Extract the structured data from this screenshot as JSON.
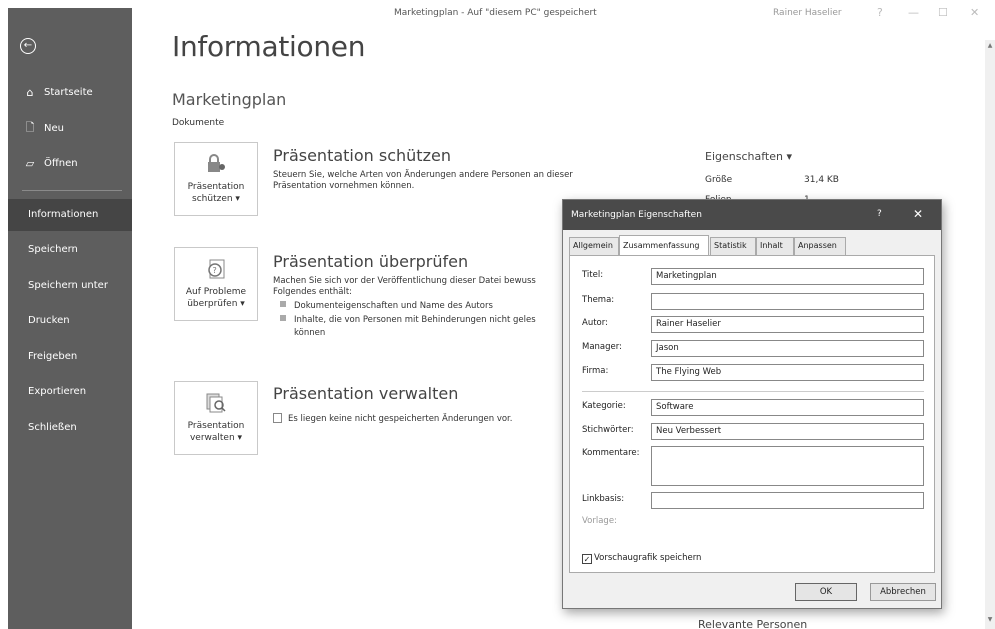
{
  "titlebar": {
    "document_title": "Marketingplan - Auf \"diesem PC\" gespeichert",
    "user": "Rainer Haselier",
    "help": "?",
    "minimize": "—",
    "maximize": "☐",
    "close": "✕"
  },
  "sidebar": {
    "back_glyph": "←",
    "top_items": [
      {
        "label": "Startseite",
        "icon": "home-icon"
      },
      {
        "label": "Neu",
        "icon": "new-document-icon"
      },
      {
        "label": "Öffnen",
        "icon": "folder-open-icon"
      }
    ],
    "items": [
      {
        "label": "Informationen",
        "active": true
      },
      {
        "label": "Speichern"
      },
      {
        "label": "Speichern unter"
      },
      {
        "label": "Drucken"
      },
      {
        "label": "Freigeben"
      },
      {
        "label": "Exportieren"
      },
      {
        "label": "Schließen"
      }
    ]
  },
  "main": {
    "title": "Informationen",
    "doc_name": "Marketingplan",
    "doc_location": "Dokumente",
    "sections": [
      {
        "tile_label_1": "Präsentation",
        "tile_label_2": "schützen ▾",
        "icon": "lock-key-icon",
        "heading": "Präsentation schützen",
        "desc_1": "Steuern Sie, welche Arten von Änderungen andere Personen an dieser",
        "desc_2": "Präsentation vornehmen können."
      },
      {
        "tile_label_1": "Auf Probleme",
        "tile_label_2": "überprüfen ▾",
        "icon": "inspect-document-icon",
        "heading": "Präsentation überprüfen",
        "desc_1": "Machen Sie sich vor der Veröffentlichung dieser Datei bewuss",
        "desc_2": "Folgendes enthält:",
        "bullets": [
          "Dokumenteigenschaften und Name des Autors",
          "Inhalte, die von Personen mit Behinderungen nicht geles",
          "können"
        ]
      },
      {
        "tile_label_1": "Präsentation",
        "tile_label_2": "verwalten ▾",
        "icon": "manage-presentation-icon",
        "heading": "Präsentation verwalten",
        "desc_1": "Es liegen keine nicht gespeicherten Änderungen vor."
      }
    ],
    "properties": {
      "heading": "Eigenschaften ▾",
      "rows": [
        {
          "label": "Größe",
          "value": "31,4 KB"
        },
        {
          "label": "Folien",
          "value": "1"
        }
      ]
    },
    "related_heading": "Relevante Personen"
  },
  "dialog": {
    "title": "Marketingplan Eigenschaften",
    "help": "?",
    "close": "✕",
    "tabs": [
      "Allgemein",
      "Zusammenfassung",
      "Statistik",
      "Inhalt",
      "Anpassen"
    ],
    "active_tab": "Zusammenfassung",
    "fields": [
      {
        "label": "Titel:",
        "value": "Marketingplan"
      },
      {
        "label": "Thema:",
        "value": ""
      },
      {
        "label": "Autor:",
        "value": "Rainer Haselier"
      },
      {
        "label": "Manager:",
        "value": "Jason"
      },
      {
        "label": "Firma:",
        "value": "The Flying Web"
      },
      {
        "label": "Kategorie:",
        "value": "Software"
      },
      {
        "label": "Stichwörter:",
        "value": "Neu Verbessert"
      },
      {
        "label": "Kommentare:",
        "value": ""
      },
      {
        "label": "Linkbasis:",
        "value": ""
      }
    ],
    "template_label": "Vorlage:",
    "checkbox_label": "Vorschaugrafik speichern",
    "checkbox_checked": true,
    "ok": "OK",
    "cancel": "Abbrechen"
  }
}
